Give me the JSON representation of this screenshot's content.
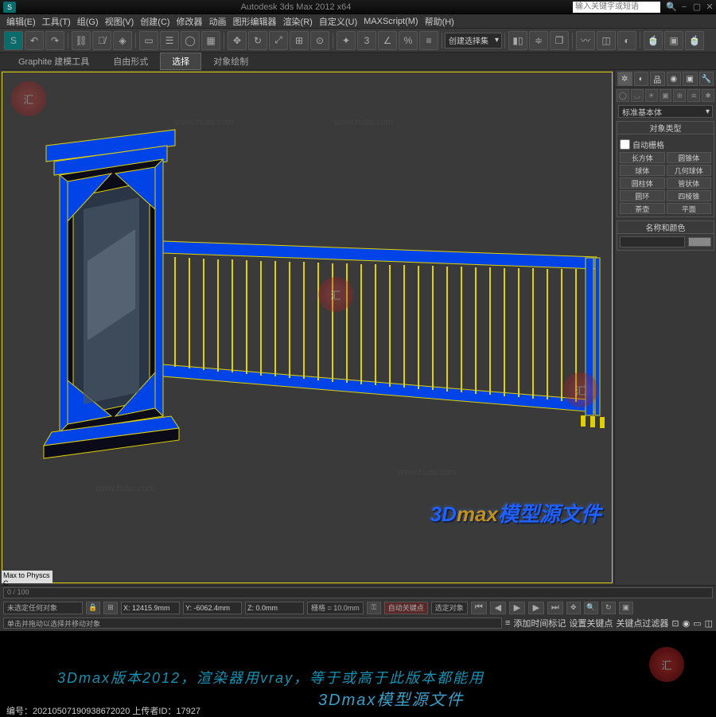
{
  "title": "Autodesk 3ds Max 2012 x64",
  "search_placeholder": "输入关键字或短语",
  "menu": [
    "编辑(E)",
    "工具(T)",
    "组(G)",
    "视图(V)",
    "创建(C)",
    "修改器",
    "动画",
    "图形编辑器",
    "渲染(R)",
    "自定义(U)",
    "MAXScript(M)",
    "帮助(H)"
  ],
  "toolbar_combo": "创建选择集",
  "subtabs": {
    "graphite": "Graphite 建模工具",
    "free": "自由形式",
    "select": "选择",
    "draw": "对象绘制"
  },
  "cmd": {
    "dropdown": "标准基本体",
    "rollout_objtype_title": "对象类型",
    "autogrid": "自动栅格",
    "primitives": [
      "长方体",
      "圆锥体",
      "球体",
      "几何球体",
      "圆柱体",
      "管状体",
      "圆环",
      "四棱锥",
      "茶壶",
      "平面"
    ],
    "rollout_namecolor_title": "名称和颜色",
    "name_value": ""
  },
  "timeline": {
    "frames": "0 / 100"
  },
  "status": {
    "mat": "Max to Physcs C",
    "none": "未选定任何对象",
    "hint": "单击并拖动以选择并移动对象",
    "x": "X: 12415.9mm",
    "y": "Y: -6062.4mm",
    "z": "Z: 0.0mm",
    "grid": "栅格 = 10.0mm",
    "autokey": "自动关键点",
    "selfilter": "选定对象",
    "addtag": "添加时间标记",
    "setkey": "设置关键点",
    "keyfilter": "关键点过滤器"
  },
  "overlay": {
    "big": "3Dmax模型源文件"
  },
  "footer": {
    "line1": "3Dmax版本2012，渲染器用vray，等于或高于此版本都能用",
    "line2": "3Dmax模型源文件",
    "id": "编号：20210507190938672020",
    "uploader": "上传者ID：17927"
  },
  "wm": {
    "site": "汇图网",
    "url": "www.huitu.com"
  }
}
